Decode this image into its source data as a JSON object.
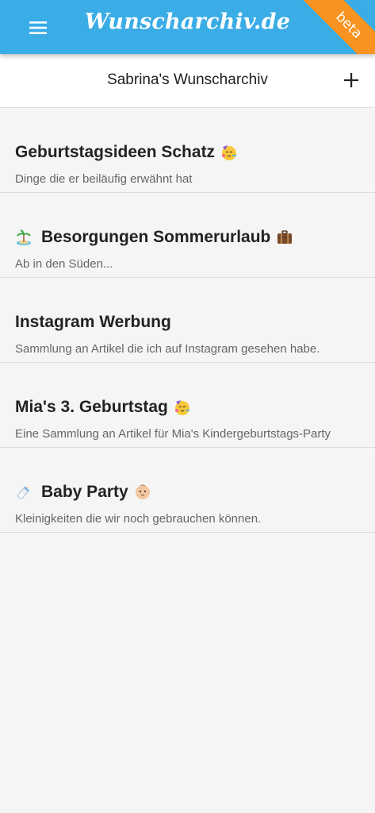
{
  "app": {
    "brand": "Wunscharchiv.de",
    "ribbon": "beta"
  },
  "header": {
    "title": "Sabrina's Wunscharchiv"
  },
  "lists": [
    {
      "title": "Geburtstagsideen Schatz",
      "description": "Dinge die er beiläufig erwähnt hat",
      "leading_icon": null,
      "trailing_icon": "party-face-emoji"
    },
    {
      "title": "Besorgungen Sommerurlaub",
      "description": "Ab in den Süden...",
      "leading_icon": "desert-island-emoji",
      "trailing_icon": "suitcase-emoji"
    },
    {
      "title": "Instagram Werbung",
      "description": "Sammlung an Artikel die ich auf Instagram gesehen habe.",
      "leading_icon": null,
      "trailing_icon": null
    },
    {
      "title": "Mia's 3. Geburtstag",
      "description": "Eine Sammlung an Artikel für Mia's Kindergeburtstags-Party",
      "leading_icon": null,
      "trailing_icon": "party-face-emoji"
    },
    {
      "title": "Baby Party",
      "description": "Kleinigkeiten die wir noch gebrauchen können.",
      "leading_icon": "baby-bottle-emoji",
      "trailing_icon": "baby-emoji"
    }
  ],
  "colors": {
    "appbar": "#3aace6",
    "ribbon": "#f7931e",
    "background": "#f5f5f5",
    "title_text": "#222222",
    "description_text": "#666666"
  }
}
